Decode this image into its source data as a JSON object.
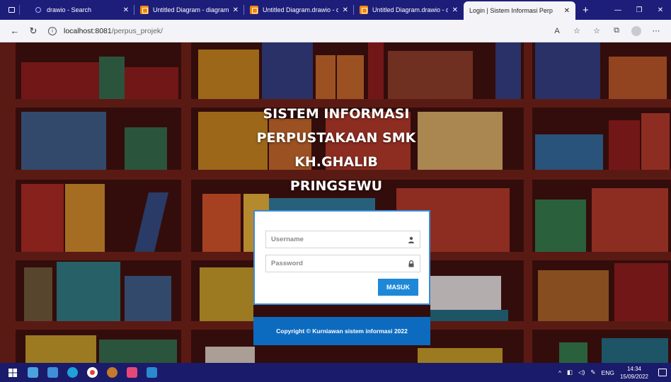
{
  "browser": {
    "tabs": [
      {
        "title": "drawio - Search",
        "icon": "search-icon"
      },
      {
        "title": "Untitled Diagram - diagrams",
        "icon": "drawio-icon"
      },
      {
        "title": "Untitled Diagram.drawio - di",
        "icon": "drawio-icon"
      },
      {
        "title": "Untitled Diagram.drawio - di",
        "icon": "drawio-icon"
      },
      {
        "title": "Login | Sistem Informasi Perp",
        "icon": "page-icon",
        "active": true
      }
    ],
    "new_tab": "+",
    "url_host": "localhost:8081",
    "url_path": "/perpus_projek/"
  },
  "page": {
    "heading_lines": [
      "SISTEM INFORMASI",
      "PERPUSTAKAAN SMK",
      "KH.GHALIB",
      "PRINGSEWU"
    ],
    "username_placeholder": "Username",
    "password_placeholder": "Password",
    "login_button": "MASUK",
    "copyright": "Copyright © Kurniawan sistem informasi 2022"
  },
  "taskbar": {
    "lang": "ENG",
    "time": "14:34",
    "date": "15/09/2022"
  },
  "colors": {
    "tabbar": "#1d1e7a",
    "taskbar": "#1b1b6b",
    "button": "#1e88d8",
    "footer": "#0d6bbf",
    "card_border": "#3a8ad6"
  }
}
